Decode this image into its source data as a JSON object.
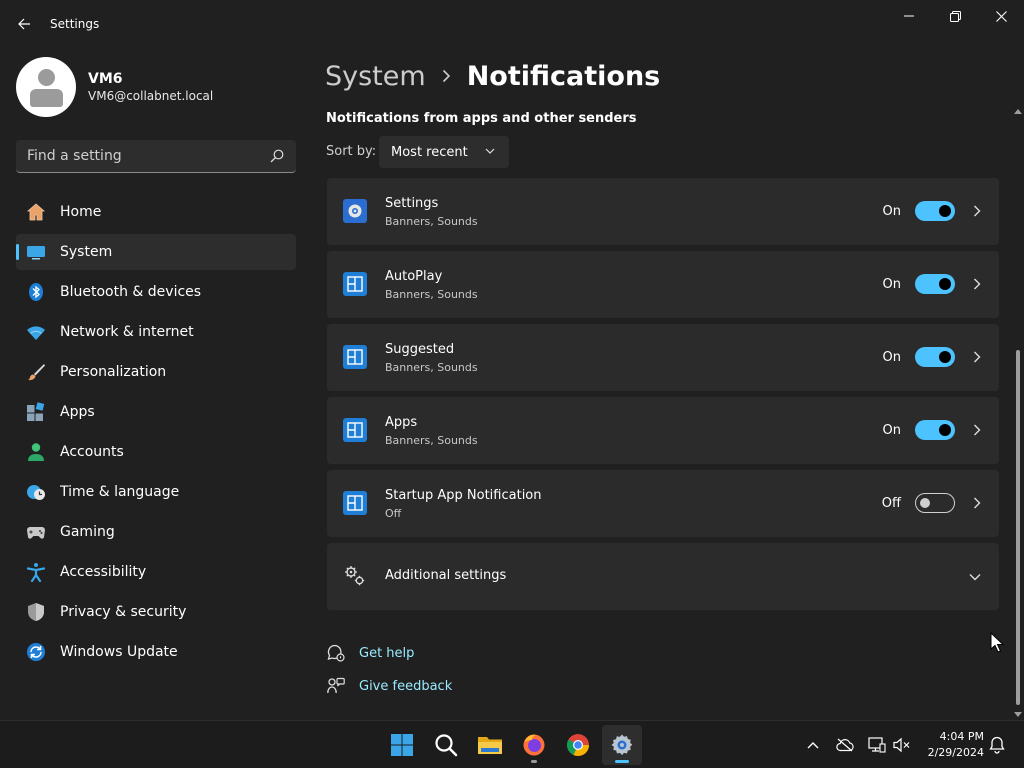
{
  "app": {
    "title": "Settings"
  },
  "colors": {
    "accent": "#4cc2ff",
    "background": "#202020",
    "card": "#2b2b2b",
    "link": "#99ebff"
  },
  "profile": {
    "name": "VM6",
    "email": "VM6@collabnet.local"
  },
  "search": {
    "placeholder": "Find a setting"
  },
  "sidebar": {
    "items": [
      {
        "label": "Home",
        "icon": "home-icon"
      },
      {
        "label": "System",
        "icon": "system-icon",
        "active": true
      },
      {
        "label": "Bluetooth & devices",
        "icon": "bluetooth-icon"
      },
      {
        "label": "Network & internet",
        "icon": "wifi-icon"
      },
      {
        "label": "Personalization",
        "icon": "brush-icon"
      },
      {
        "label": "Apps",
        "icon": "apps-icon"
      },
      {
        "label": "Accounts",
        "icon": "person-icon"
      },
      {
        "label": "Time & language",
        "icon": "globe-clock-icon"
      },
      {
        "label": "Gaming",
        "icon": "gamepad-icon"
      },
      {
        "label": "Accessibility",
        "icon": "accessibility-icon"
      },
      {
        "label": "Privacy & security",
        "icon": "shield-icon"
      },
      {
        "label": "Windows Update",
        "icon": "update-icon"
      }
    ]
  },
  "breadcrumb": {
    "parent": "System",
    "current": "Notifications"
  },
  "main": {
    "section_title": "Notifications from apps and other senders",
    "sort_label": "Sort by:",
    "sort_value": "Most recent",
    "apps": [
      {
        "name": "Settings",
        "detail": "Banners, Sounds",
        "state": "On",
        "on": true,
        "icon": "settings-gear-icon"
      },
      {
        "name": "AutoPlay",
        "detail": "Banners, Sounds",
        "state": "On",
        "on": true,
        "icon": "generic-app-icon"
      },
      {
        "name": "Suggested",
        "detail": "Banners, Sounds",
        "state": "On",
        "on": true,
        "icon": "generic-app-icon"
      },
      {
        "name": "Apps",
        "detail": "Banners, Sounds",
        "state": "On",
        "on": true,
        "icon": "generic-app-icon"
      },
      {
        "name": "Startup App Notification",
        "detail": "Off",
        "state": "Off",
        "on": false,
        "icon": "generic-app-icon"
      }
    ],
    "additional_settings": "Additional settings",
    "links": {
      "help": "Get help",
      "feedback": "Give feedback"
    }
  },
  "taskbar": {
    "apps": [
      "windows-start-icon",
      "search-icon",
      "file-explorer-icon",
      "firefox-icon",
      "chrome-icon",
      "settings-icon"
    ],
    "time": "4:04 PM",
    "date": "2/29/2024"
  }
}
